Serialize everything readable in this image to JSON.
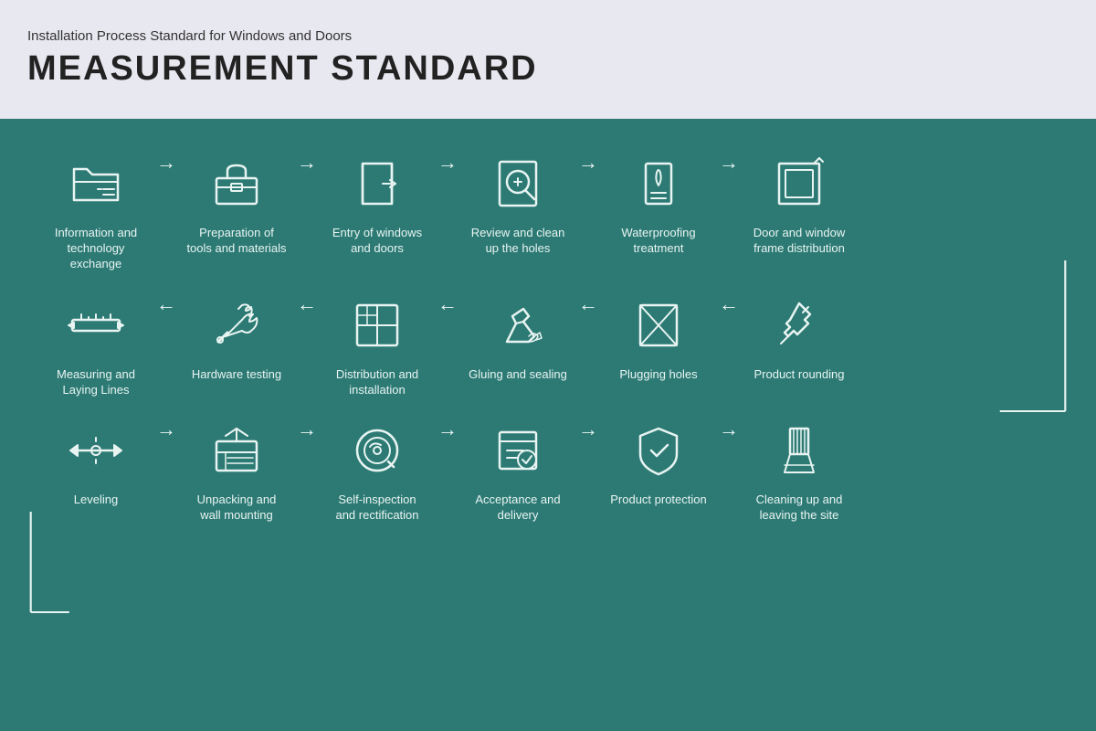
{
  "header": {
    "subtitle": "Installation Process Standard for Windows and Doors",
    "title": "MEASUREMENT STANDARD"
  },
  "row1": [
    {
      "id": "info-exchange",
      "label": "Information and technology exchange",
      "icon": "folder"
    },
    {
      "id": "prep-tools",
      "label": "Preparation of tools and materials",
      "icon": "toolbox"
    },
    {
      "id": "entry-windows",
      "label": "Entry of windows and doors",
      "icon": "door-entry"
    },
    {
      "id": "review-holes",
      "label": "Review and clean up the holes",
      "icon": "magnify"
    },
    {
      "id": "waterproofing",
      "label": "Waterproofing treatment",
      "icon": "waterproof"
    },
    {
      "id": "frame-dist",
      "label": "Door and window frame distribution",
      "icon": "frame"
    }
  ],
  "row2": [
    {
      "id": "measuring",
      "label": "Measuring and Laying Lines",
      "icon": "measure"
    },
    {
      "id": "hardware",
      "label": "Hardware testing",
      "icon": "wrench"
    },
    {
      "id": "distribution",
      "label": "Distribution and installation",
      "icon": "grid"
    },
    {
      "id": "gluing",
      "label": "Gluing and sealing",
      "icon": "glue"
    },
    {
      "id": "plugging",
      "label": "Plugging holes",
      "icon": "plug"
    },
    {
      "id": "rounding",
      "label": "Product rounding",
      "icon": "pin"
    }
  ],
  "row3": [
    {
      "id": "leveling",
      "label": "Leveling",
      "icon": "level"
    },
    {
      "id": "unpacking",
      "label": "Unpacking and wall mounting",
      "icon": "unpack"
    },
    {
      "id": "inspection",
      "label": "Self-inspection and rectification",
      "icon": "inspect"
    },
    {
      "id": "acceptance",
      "label": "Acceptance and delivery",
      "icon": "accept"
    },
    {
      "id": "protection",
      "label": "Product protection",
      "icon": "protect"
    },
    {
      "id": "cleanup",
      "label": "Cleaning up and leaving the site",
      "icon": "clean"
    }
  ]
}
